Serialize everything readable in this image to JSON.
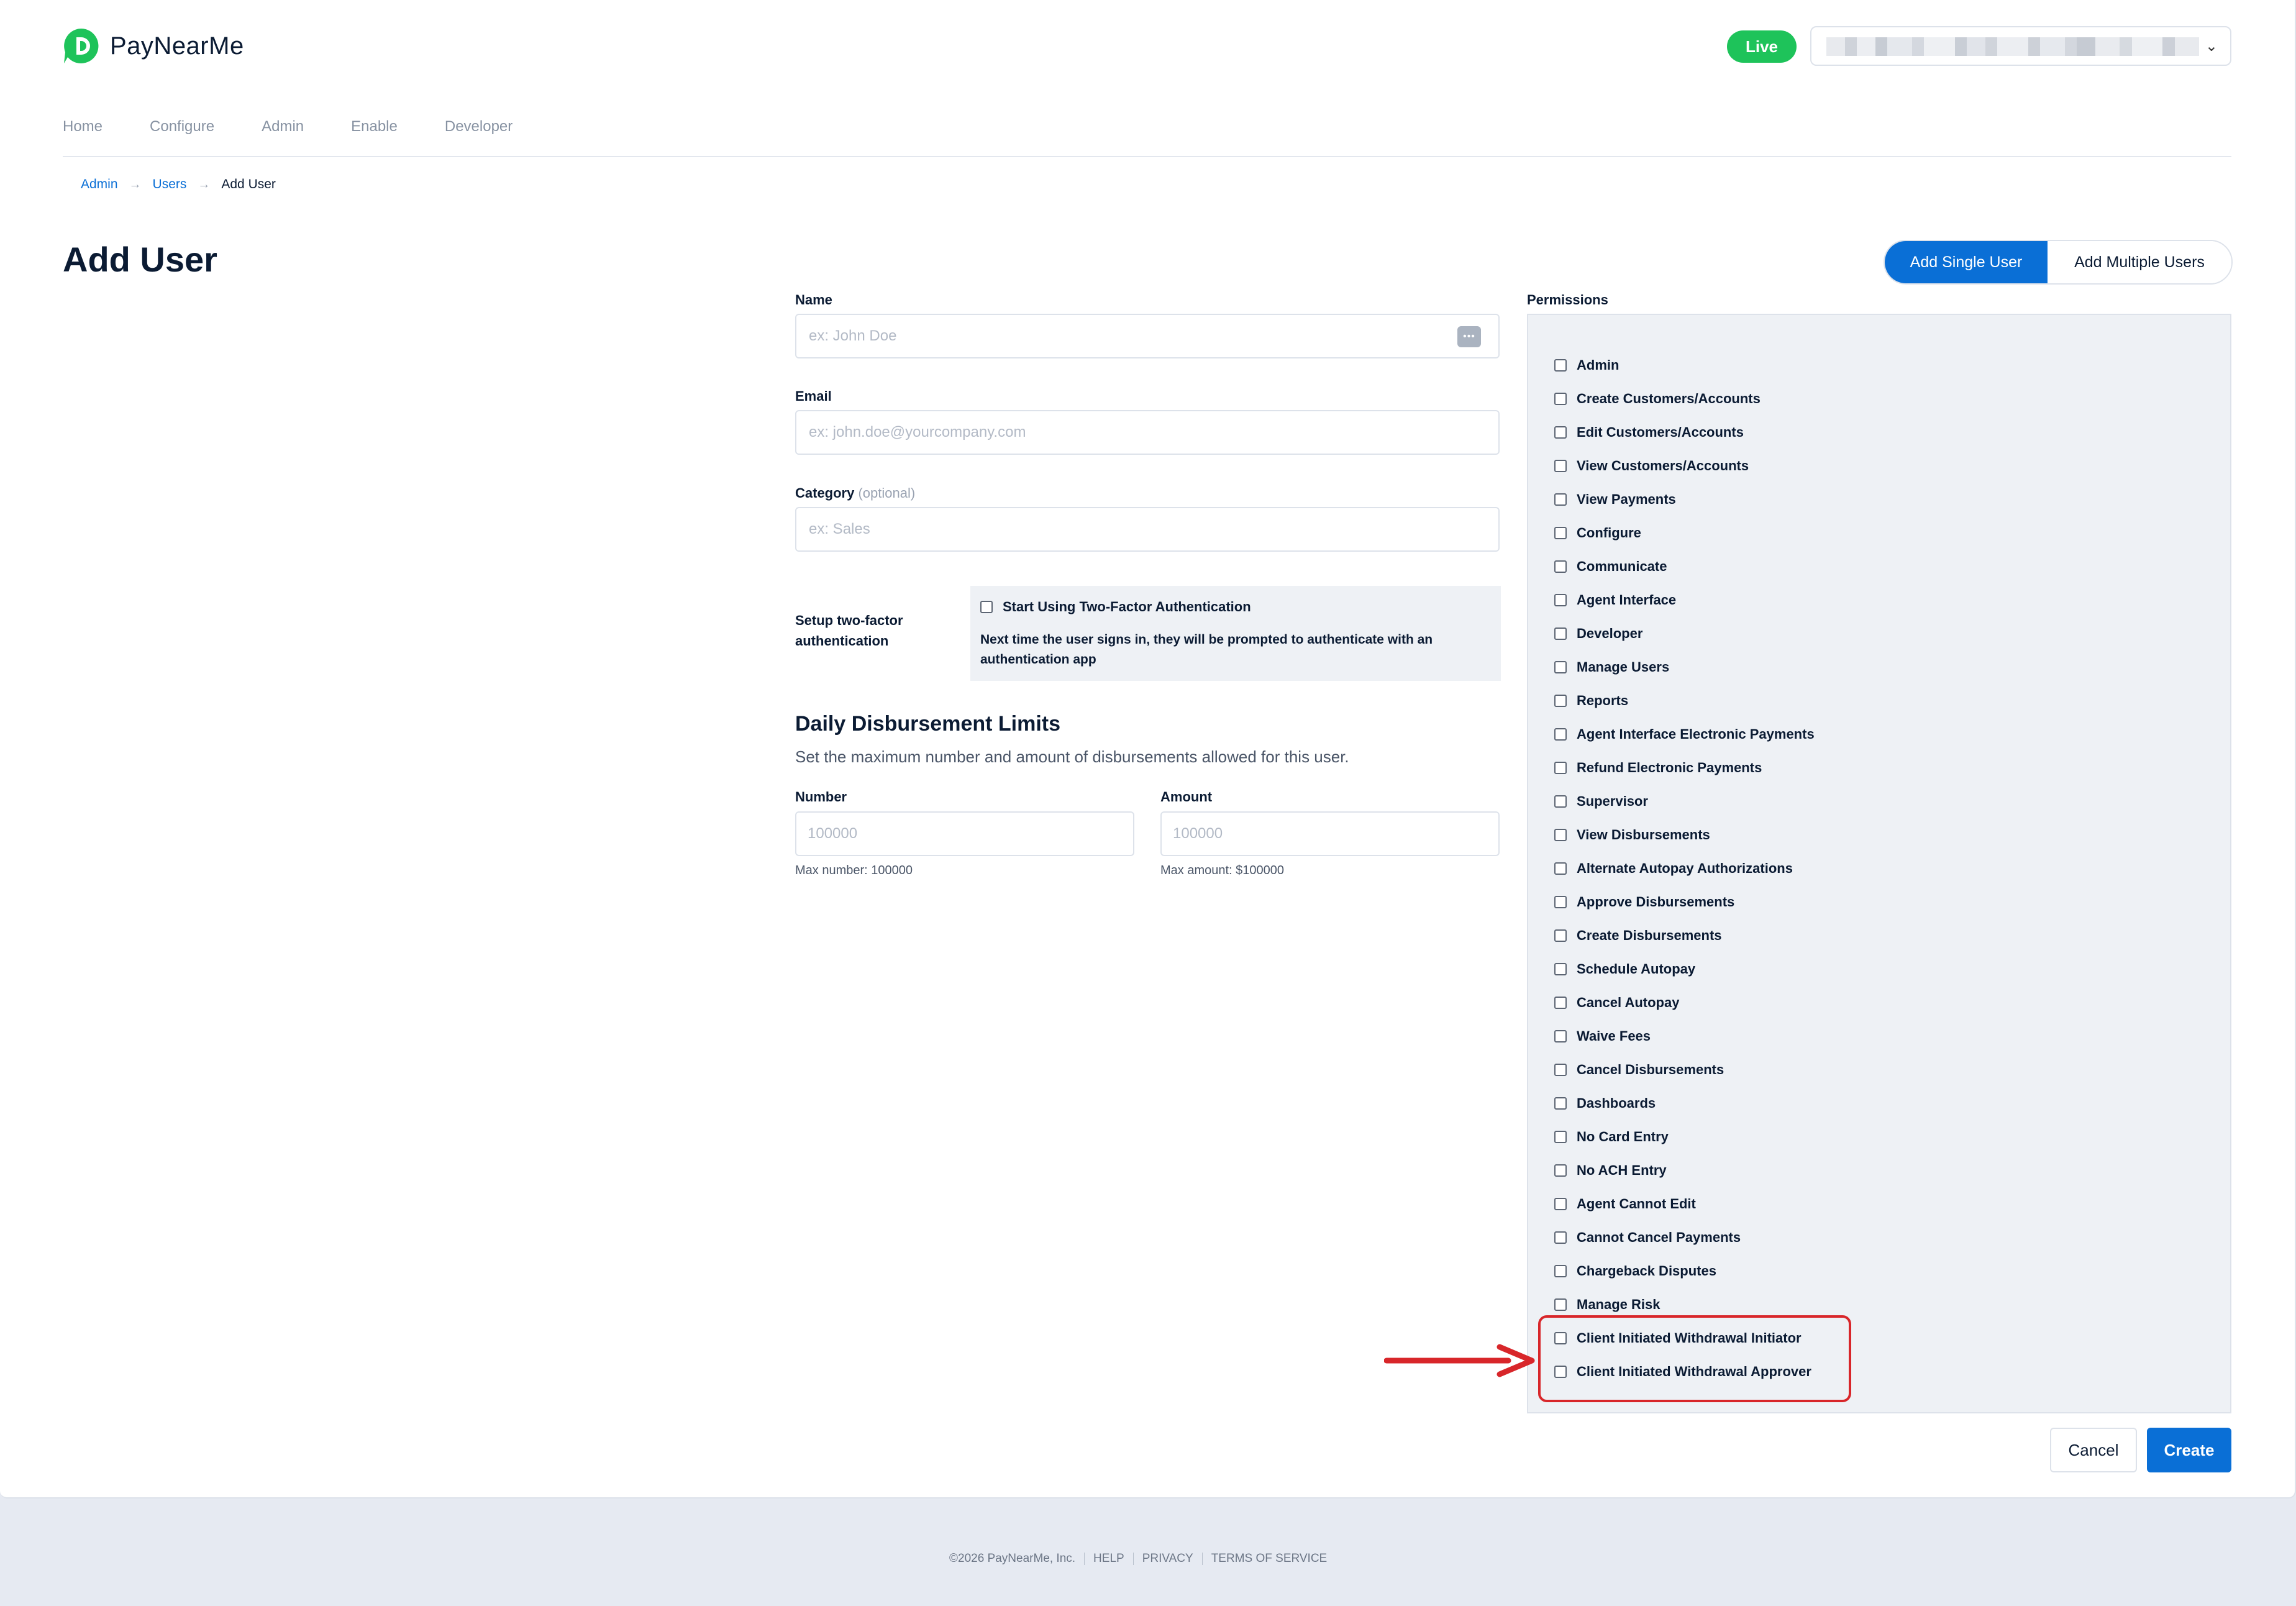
{
  "brand": {
    "name": "PayNearMe",
    "accent": "#0a6fd6",
    "logo_green": "#1ec35a"
  },
  "header": {
    "live_badge": "Live",
    "account_selector": {
      "value": "",
      "icon": "chevron-down-icon"
    }
  },
  "nav": {
    "items": [
      "Home",
      "Configure",
      "Admin",
      "Enable",
      "Developer"
    ]
  },
  "breadcrumb": {
    "items": [
      "Admin",
      "Users",
      "Add User"
    ],
    "separator": "→"
  },
  "page": {
    "title": "Add User"
  },
  "mode_toggle": {
    "single": "Add Single User",
    "multiple": "Add Multiple Users",
    "selected": "Add Single User"
  },
  "form": {
    "name": {
      "label": "Name",
      "placeholder": "ex: John Doe"
    },
    "email": {
      "label": "Email",
      "placeholder": "ex: john.doe@yourcompany.com"
    },
    "category": {
      "label": "Category",
      "optional": "(optional)",
      "placeholder": "ex: Sales"
    },
    "two_factor": {
      "label": "Setup two-factor authentication",
      "checkbox_label": "Start Using Two-Factor Authentication",
      "description": "Next time the user signs in, they will be prompted to authenticate with an authentication app",
      "checked": false
    },
    "limits": {
      "title": "Daily Disbursement Limits",
      "subtitle": "Set the maximum number and amount of disbursements allowed for this user.",
      "number": {
        "label": "Number",
        "placeholder": "100000",
        "hint": "Max number: 100000"
      },
      "amount": {
        "label": "Amount",
        "placeholder": "100000",
        "hint": "Max amount: $100000"
      }
    }
  },
  "permissions": {
    "label": "Permissions",
    "items": [
      "Admin",
      "Create Customers/Accounts",
      "Edit Customers/Accounts",
      "View Customers/Accounts",
      "View Payments",
      "Configure",
      "Communicate",
      "Agent Interface",
      "Developer",
      "Manage Users",
      "Reports",
      "Agent Interface Electronic Payments",
      "Refund Electronic Payments",
      "Supervisor",
      "View Disbursements",
      "Alternate Autopay Authorizations",
      "Approve Disbursements",
      "Create Disbursements",
      "Schedule Autopay",
      "Cancel Autopay",
      "Waive Fees",
      "Cancel Disbursements",
      "Dashboards",
      "No Card Entry",
      "No ACH Entry",
      "Agent Cannot Edit",
      "Cannot Cancel Payments",
      "Chargeback Disputes",
      "Manage Risk",
      "Client Initiated Withdrawal Initiator",
      "Client Initiated Withdrawal Approver"
    ],
    "highlight_color": "#d8262a"
  },
  "actions": {
    "cancel": "Cancel",
    "create": "Create"
  },
  "footer": {
    "copyright": "©2026 PayNearMe, Inc.",
    "links": [
      "HELP",
      "PRIVACY",
      "TERMS OF SERVICE"
    ]
  }
}
